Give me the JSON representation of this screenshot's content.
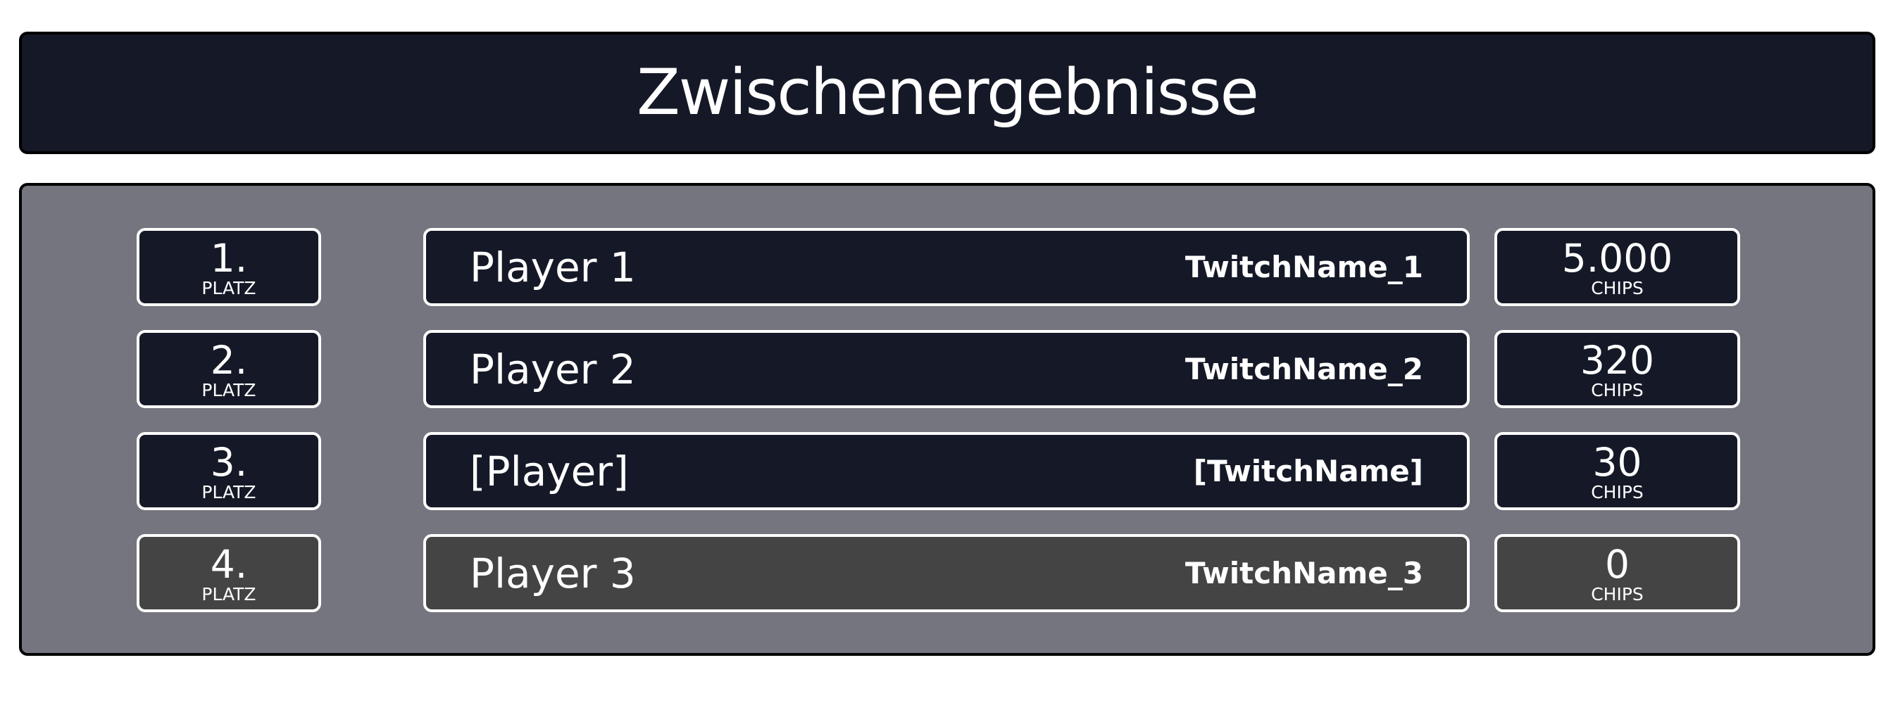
{
  "header": {
    "title": "Zwischenergebnisse"
  },
  "colors": {
    "panel_dark": "#151927",
    "panel_dimmed": "#444444",
    "board_bg": "#75757f",
    "border": "#ffffff",
    "text": "#ffffff"
  },
  "standings": [
    {
      "rank": "1.",
      "rank_label": "PLATZ",
      "player": "Player 1",
      "twitch": "TwitchName_1",
      "chips": "5.000",
      "chips_label": "CHIPS",
      "dimmed": false
    },
    {
      "rank": "2.",
      "rank_label": "PLATZ",
      "player": "Player 2",
      "twitch": "TwitchName_2",
      "chips": "320",
      "chips_label": "CHIPS",
      "dimmed": false
    },
    {
      "rank": "3.",
      "rank_label": "PLATZ",
      "player": "[Player]",
      "twitch": "[TwitchName]",
      "chips": "30",
      "chips_label": "CHIPS",
      "dimmed": false
    },
    {
      "rank": "4.",
      "rank_label": "PLATZ",
      "player": "Player 3",
      "twitch": "TwitchName_3",
      "chips": "0",
      "chips_label": "CHIPS",
      "dimmed": true
    }
  ]
}
